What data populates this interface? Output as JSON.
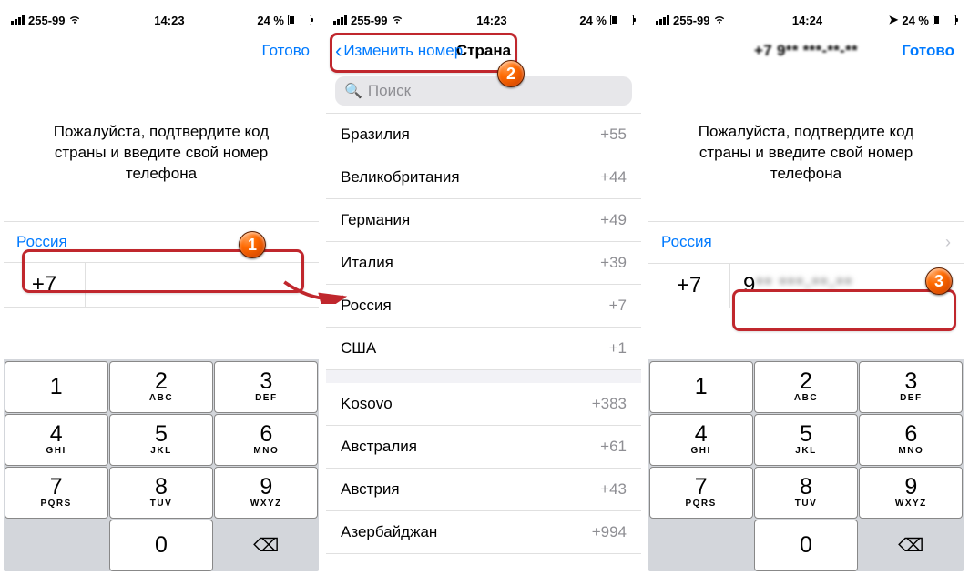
{
  "status": {
    "carrier": "255-99",
    "time_a": "14:23",
    "time_b": "14:24",
    "battery": "24 %"
  },
  "nav": {
    "done": "Готово",
    "back_change_number": "Изменить номер",
    "country_title": "Страна"
  },
  "header_phone_masked": "+7 9** ***-**-**",
  "instruction": "Пожалуйста, подтвердите код страны и введите свой номер телефона",
  "country_selected": "Россия",
  "dial_code": "+7",
  "entered_number_clear": "9",
  "entered_number_blur": "** ***-**-**",
  "search_placeholder": "Поиск",
  "countries_top": [
    {
      "name": "Бразилия",
      "code": "+55"
    },
    {
      "name": "Великобритания",
      "code": "+44"
    },
    {
      "name": "Германия",
      "code": "+49"
    },
    {
      "name": "Италия",
      "code": "+39"
    },
    {
      "name": "Россия",
      "code": "+7"
    },
    {
      "name": "США",
      "code": "+1"
    }
  ],
  "countries_bottom": [
    {
      "name": "Kosovo",
      "code": "+383"
    },
    {
      "name": "Австралия",
      "code": "+61"
    },
    {
      "name": "Австрия",
      "code": "+43"
    },
    {
      "name": "Азербайджан",
      "code": "+994"
    }
  ],
  "keypad": [
    {
      "d": "1",
      "l": ""
    },
    {
      "d": "2",
      "l": "ABC"
    },
    {
      "d": "3",
      "l": "DEF"
    },
    {
      "d": "4",
      "l": "GHI"
    },
    {
      "d": "5",
      "l": "JKL"
    },
    {
      "d": "6",
      "l": "MNO"
    },
    {
      "d": "7",
      "l": "PQRS"
    },
    {
      "d": "8",
      "l": "TUV"
    },
    {
      "d": "9",
      "l": "WXYZ"
    },
    {
      "d": "0",
      "l": ""
    }
  ],
  "badges": {
    "b1": "1",
    "b2": "2",
    "b3": "3"
  }
}
